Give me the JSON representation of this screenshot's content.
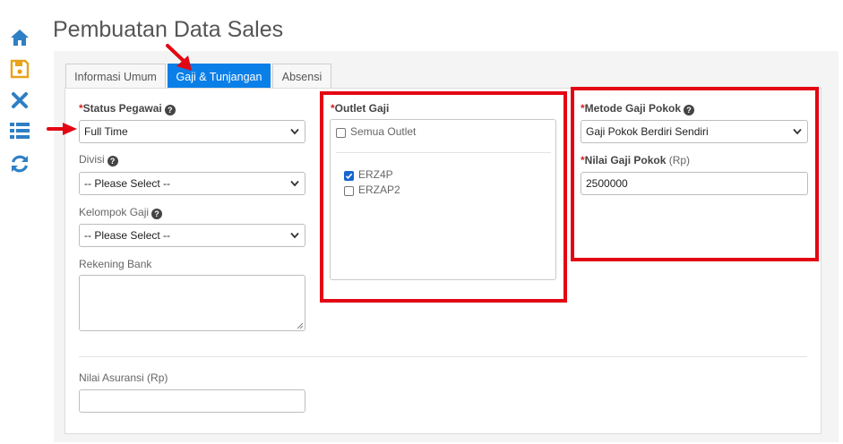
{
  "page": {
    "title": "Pembuatan Data Sales"
  },
  "sidebar": {
    "icons": [
      "home-icon",
      "save-icon",
      "close-icon",
      "list-icon",
      "refresh-icon"
    ],
    "colors": {
      "primary": "#2e7fc4",
      "save": "#e9a21b"
    }
  },
  "tabs": [
    {
      "label": "Informasi Umum"
    },
    {
      "label": "Gaji & Tunjangan",
      "active": true
    },
    {
      "label": "Absensi"
    }
  ],
  "form": {
    "required_mark": "*",
    "status_pegawai": {
      "label": "Status Pegawai",
      "value": "Full Time"
    },
    "divisi": {
      "label": "Divisi",
      "value": "-- Please Select --"
    },
    "kelompok_gaji": {
      "label": "Kelompok Gaji",
      "value": "-- Please Select --"
    },
    "rekening_bank": {
      "label": "Rekening Bank",
      "value": ""
    },
    "nilai_asuransi": {
      "label": "Nilai Asuransi (Rp)",
      "value": ""
    },
    "outlet_gaji": {
      "label": "Outlet Gaji",
      "semua_outlet": "Semua Outlet",
      "items": [
        {
          "label": "ERZ4P",
          "checked": true
        },
        {
          "label": "ERZAP2",
          "checked": false
        }
      ]
    },
    "metode_gaji_pokok": {
      "label": "Metode Gaji Pokok",
      "value": "Gaji Pokok Berdiri Sendiri"
    },
    "nilai_gaji_pokok": {
      "label": "Nilai Gaji Pokok",
      "suffix": "(Rp)",
      "value": "2500000"
    }
  },
  "annotations": {
    "color": "#e30613"
  },
  "colors": {
    "accent": "#0b7fe8",
    "required": "#d9211f"
  }
}
